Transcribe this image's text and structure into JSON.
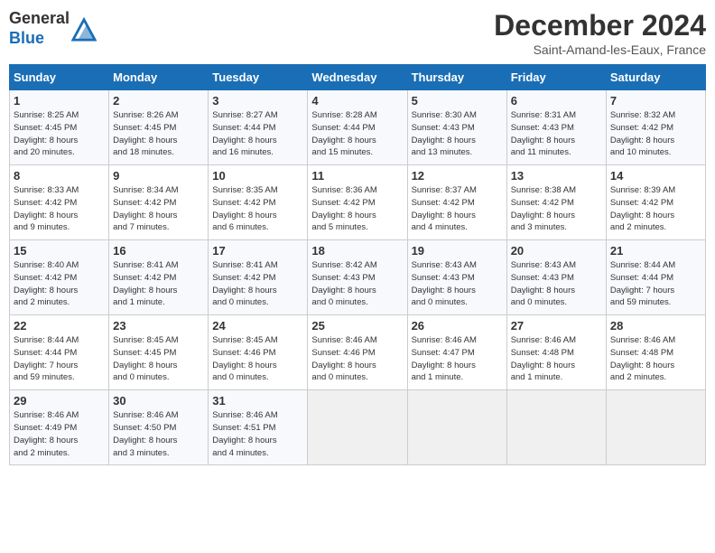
{
  "header": {
    "logo_line1": "General",
    "logo_line2": "Blue",
    "month": "December 2024",
    "location": "Saint-Amand-les-Eaux, France"
  },
  "days_of_week": [
    "Sunday",
    "Monday",
    "Tuesday",
    "Wednesday",
    "Thursday",
    "Friday",
    "Saturday"
  ],
  "weeks": [
    [
      {
        "day": "1",
        "info": "Sunrise: 8:25 AM\nSunset: 4:45 PM\nDaylight: 8 hours\nand 20 minutes."
      },
      {
        "day": "2",
        "info": "Sunrise: 8:26 AM\nSunset: 4:45 PM\nDaylight: 8 hours\nand 18 minutes."
      },
      {
        "day": "3",
        "info": "Sunrise: 8:27 AM\nSunset: 4:44 PM\nDaylight: 8 hours\nand 16 minutes."
      },
      {
        "day": "4",
        "info": "Sunrise: 8:28 AM\nSunset: 4:44 PM\nDaylight: 8 hours\nand 15 minutes."
      },
      {
        "day": "5",
        "info": "Sunrise: 8:30 AM\nSunset: 4:43 PM\nDaylight: 8 hours\nand 13 minutes."
      },
      {
        "day": "6",
        "info": "Sunrise: 8:31 AM\nSunset: 4:43 PM\nDaylight: 8 hours\nand 11 minutes."
      },
      {
        "day": "7",
        "info": "Sunrise: 8:32 AM\nSunset: 4:42 PM\nDaylight: 8 hours\nand 10 minutes."
      }
    ],
    [
      {
        "day": "8",
        "info": "Sunrise: 8:33 AM\nSunset: 4:42 PM\nDaylight: 8 hours\nand 9 minutes."
      },
      {
        "day": "9",
        "info": "Sunrise: 8:34 AM\nSunset: 4:42 PM\nDaylight: 8 hours\nand 7 minutes."
      },
      {
        "day": "10",
        "info": "Sunrise: 8:35 AM\nSunset: 4:42 PM\nDaylight: 8 hours\nand 6 minutes."
      },
      {
        "day": "11",
        "info": "Sunrise: 8:36 AM\nSunset: 4:42 PM\nDaylight: 8 hours\nand 5 minutes."
      },
      {
        "day": "12",
        "info": "Sunrise: 8:37 AM\nSunset: 4:42 PM\nDaylight: 8 hours\nand 4 minutes."
      },
      {
        "day": "13",
        "info": "Sunrise: 8:38 AM\nSunset: 4:42 PM\nDaylight: 8 hours\nand 3 minutes."
      },
      {
        "day": "14",
        "info": "Sunrise: 8:39 AM\nSunset: 4:42 PM\nDaylight: 8 hours\nand 2 minutes."
      }
    ],
    [
      {
        "day": "15",
        "info": "Sunrise: 8:40 AM\nSunset: 4:42 PM\nDaylight: 8 hours\nand 2 minutes."
      },
      {
        "day": "16",
        "info": "Sunrise: 8:41 AM\nSunset: 4:42 PM\nDaylight: 8 hours\nand 1 minute."
      },
      {
        "day": "17",
        "info": "Sunrise: 8:41 AM\nSunset: 4:42 PM\nDaylight: 8 hours\nand 0 minutes."
      },
      {
        "day": "18",
        "info": "Sunrise: 8:42 AM\nSunset: 4:43 PM\nDaylight: 8 hours\nand 0 minutes."
      },
      {
        "day": "19",
        "info": "Sunrise: 8:43 AM\nSunset: 4:43 PM\nDaylight: 8 hours\nand 0 minutes."
      },
      {
        "day": "20",
        "info": "Sunrise: 8:43 AM\nSunset: 4:43 PM\nDaylight: 8 hours\nand 0 minutes."
      },
      {
        "day": "21",
        "info": "Sunrise: 8:44 AM\nSunset: 4:44 PM\nDaylight: 7 hours\nand 59 minutes."
      }
    ],
    [
      {
        "day": "22",
        "info": "Sunrise: 8:44 AM\nSunset: 4:44 PM\nDaylight: 7 hours\nand 59 minutes."
      },
      {
        "day": "23",
        "info": "Sunrise: 8:45 AM\nSunset: 4:45 PM\nDaylight: 8 hours\nand 0 minutes."
      },
      {
        "day": "24",
        "info": "Sunrise: 8:45 AM\nSunset: 4:46 PM\nDaylight: 8 hours\nand 0 minutes."
      },
      {
        "day": "25",
        "info": "Sunrise: 8:46 AM\nSunset: 4:46 PM\nDaylight: 8 hours\nand 0 minutes."
      },
      {
        "day": "26",
        "info": "Sunrise: 8:46 AM\nSunset: 4:47 PM\nDaylight: 8 hours\nand 1 minute."
      },
      {
        "day": "27",
        "info": "Sunrise: 8:46 AM\nSunset: 4:48 PM\nDaylight: 8 hours\nand 1 minute."
      },
      {
        "day": "28",
        "info": "Sunrise: 8:46 AM\nSunset: 4:48 PM\nDaylight: 8 hours\nand 2 minutes."
      }
    ],
    [
      {
        "day": "29",
        "info": "Sunrise: 8:46 AM\nSunset: 4:49 PM\nDaylight: 8 hours\nand 2 minutes."
      },
      {
        "day": "30",
        "info": "Sunrise: 8:46 AM\nSunset: 4:50 PM\nDaylight: 8 hours\nand 3 minutes."
      },
      {
        "day": "31",
        "info": "Sunrise: 8:46 AM\nSunset: 4:51 PM\nDaylight: 8 hours\nand 4 minutes."
      },
      null,
      null,
      null,
      null
    ]
  ]
}
